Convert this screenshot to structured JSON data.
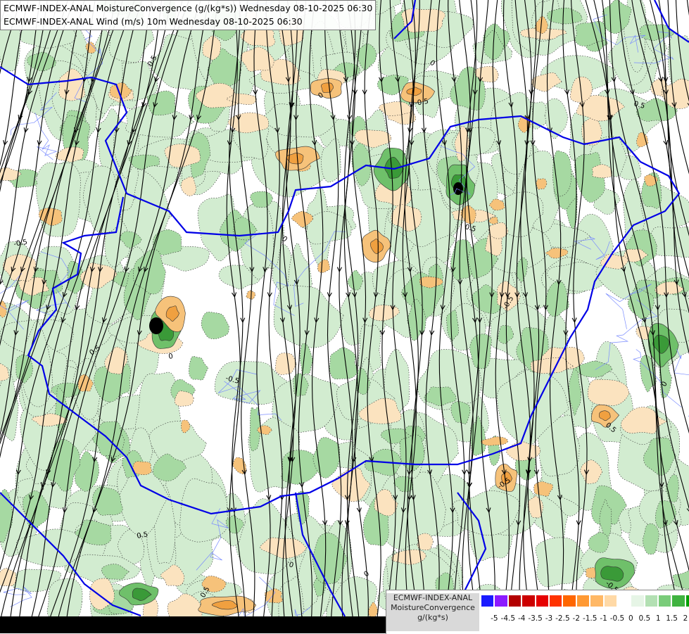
{
  "title_lines": [
    "ECMWF-INDEX-ANAL MoistureConvergence (g/(kg*s)) Wednesday 08-10-2025 06:30",
    "ECMWF-INDEX-ANAL Wind (m/s) 10m Wednesday 08-10-2025 06:30"
  ],
  "legend": {
    "title": [
      "ECMWF-INDEX-ANAL",
      "MoistureConvergence",
      "g/(kg*s)"
    ],
    "colors": [
      "#1a1aff",
      "#8c1aff",
      "#b30000",
      "#cc0000",
      "#e60000",
      "#ff3300",
      "#ff6600",
      "#ff9933",
      "#ffb866",
      "#ffd9a6",
      "#ffffff",
      "#e6f5e6",
      "#b3e0b3",
      "#7acc7a",
      "#40b340",
      "#00a000"
    ],
    "ticks": [
      "-5",
      "-4.5",
      "-4",
      "-3.5",
      "-3",
      "-2.5",
      "-2",
      "-1.5",
      "-1",
      "-0.5",
      "0",
      "0.5",
      "1",
      "1.5",
      "2"
    ]
  },
  "contour_labels": [
    "0.5",
    "0",
    "-0.5"
  ],
  "map_colors": {
    "positive": [
      "#d2ecd0",
      "#a6d9a2",
      "#6fc06a",
      "#3a9a38"
    ],
    "negative": [
      "#fbe3bf",
      "#f6c27a",
      "#f0a040"
    ],
    "border": "#0000e6",
    "streamline": "#000000"
  }
}
